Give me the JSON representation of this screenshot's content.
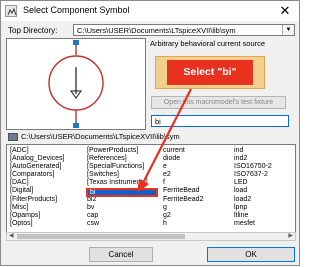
{
  "window": {
    "title": "Select Component Symbol",
    "close": "✕"
  },
  "top_directory": {
    "label": "Top Directory:",
    "value": "C:\\Users\\USER\\Documents\\LTspiceXVII\\lib\\sym"
  },
  "preview": {
    "description": "Arbitrary behavioral current source"
  },
  "callout": {
    "text": "Select \"bi\""
  },
  "open_fixture_button": {
    "label": "Open this macromodel's test fixture"
  },
  "search": {
    "value": "bi"
  },
  "current_path": "C:\\Users\\USER\\Documents\\LTspiceXVII\\lib\\sym",
  "list": {
    "columns": [
      [
        "[ADC]",
        "[Analog_Devices]",
        "[AutoGenerated]",
        "[Comparators]",
        "[DAC]",
        "[Digital]",
        "[FilterProducts]",
        "[Misc]",
        "[Opamps]",
        "[Optos]"
      ],
      [
        "[PowerProducts]",
        "[References]",
        "[SpecialFunctions]",
        "[Switches]",
        "[Texas Instruments]",
        "",
        "bi2",
        "bv",
        "cap",
        "csw"
      ],
      [
        "current",
        "diode",
        "e",
        "e2",
        "f",
        "FerriteBead",
        "FerriteBead2",
        "g",
        "g2",
        "h"
      ],
      [
        "ind",
        "ind2",
        "ISO16750-2",
        "ISO7637-2",
        "LED",
        "load",
        "load2",
        "lpnp",
        "ltline",
        "mesfet"
      ]
    ],
    "selected": "bi"
  },
  "buttons": {
    "cancel": "Cancel",
    "ok": "OK"
  },
  "colors": {
    "accent": "#e8311f",
    "selection": "#1160c9",
    "callout_bg": "#f2cf8f",
    "symbol_red": "#c0302a"
  }
}
